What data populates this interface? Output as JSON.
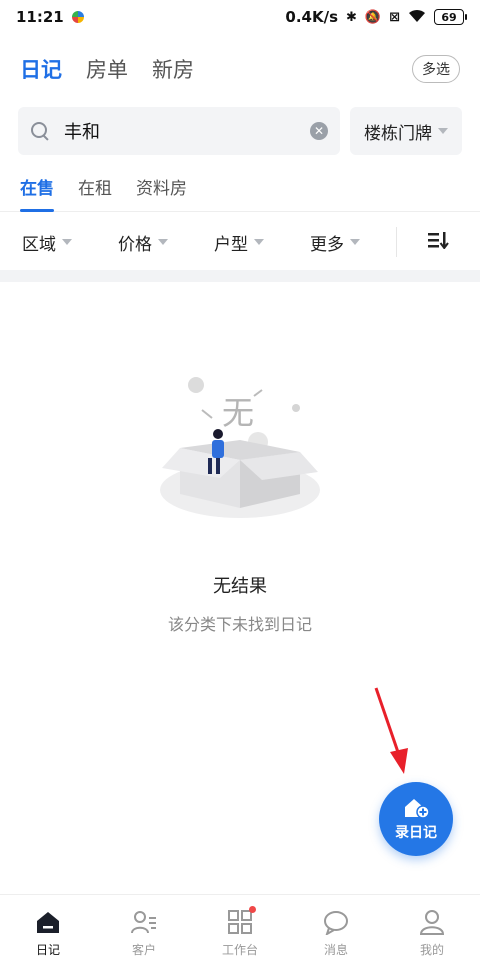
{
  "status_bar": {
    "time": "11:21",
    "network_speed": "0.4K/s",
    "battery": "69"
  },
  "top_nav": {
    "tabs": [
      {
        "label": "日记",
        "active": true
      },
      {
        "label": "房单",
        "active": false
      },
      {
        "label": "新房",
        "active": false
      }
    ],
    "multi_select_label": "多选"
  },
  "search": {
    "value": "丰和",
    "building_filter_label": "楼栋门牌"
  },
  "sub_tabs": [
    {
      "label": "在售",
      "active": true
    },
    {
      "label": "在租",
      "active": false
    },
    {
      "label": "资料房",
      "active": false
    }
  ],
  "filters": [
    {
      "label": "区域"
    },
    {
      "label": "价格"
    },
    {
      "label": "户型"
    },
    {
      "label": "更多"
    }
  ],
  "empty_state": {
    "illustration_text": "无",
    "title": "无结果",
    "subtitle": "该分类下未找到日记"
  },
  "fab": {
    "label": "录日记"
  },
  "bottom_nav": [
    {
      "label": "日记",
      "icon": "diary-icon",
      "active": true
    },
    {
      "label": "客户",
      "icon": "customer-icon",
      "active": false
    },
    {
      "label": "工作台",
      "icon": "workbench-icon",
      "active": false,
      "badge": true
    },
    {
      "label": "消息",
      "icon": "message-icon",
      "active": false
    },
    {
      "label": "我的",
      "icon": "profile-icon",
      "active": false
    }
  ],
  "colors": {
    "accent": "#1f6fe5",
    "fab": "#2477e6",
    "annotation_arrow": "#e8202a",
    "badge": "#f04848"
  }
}
